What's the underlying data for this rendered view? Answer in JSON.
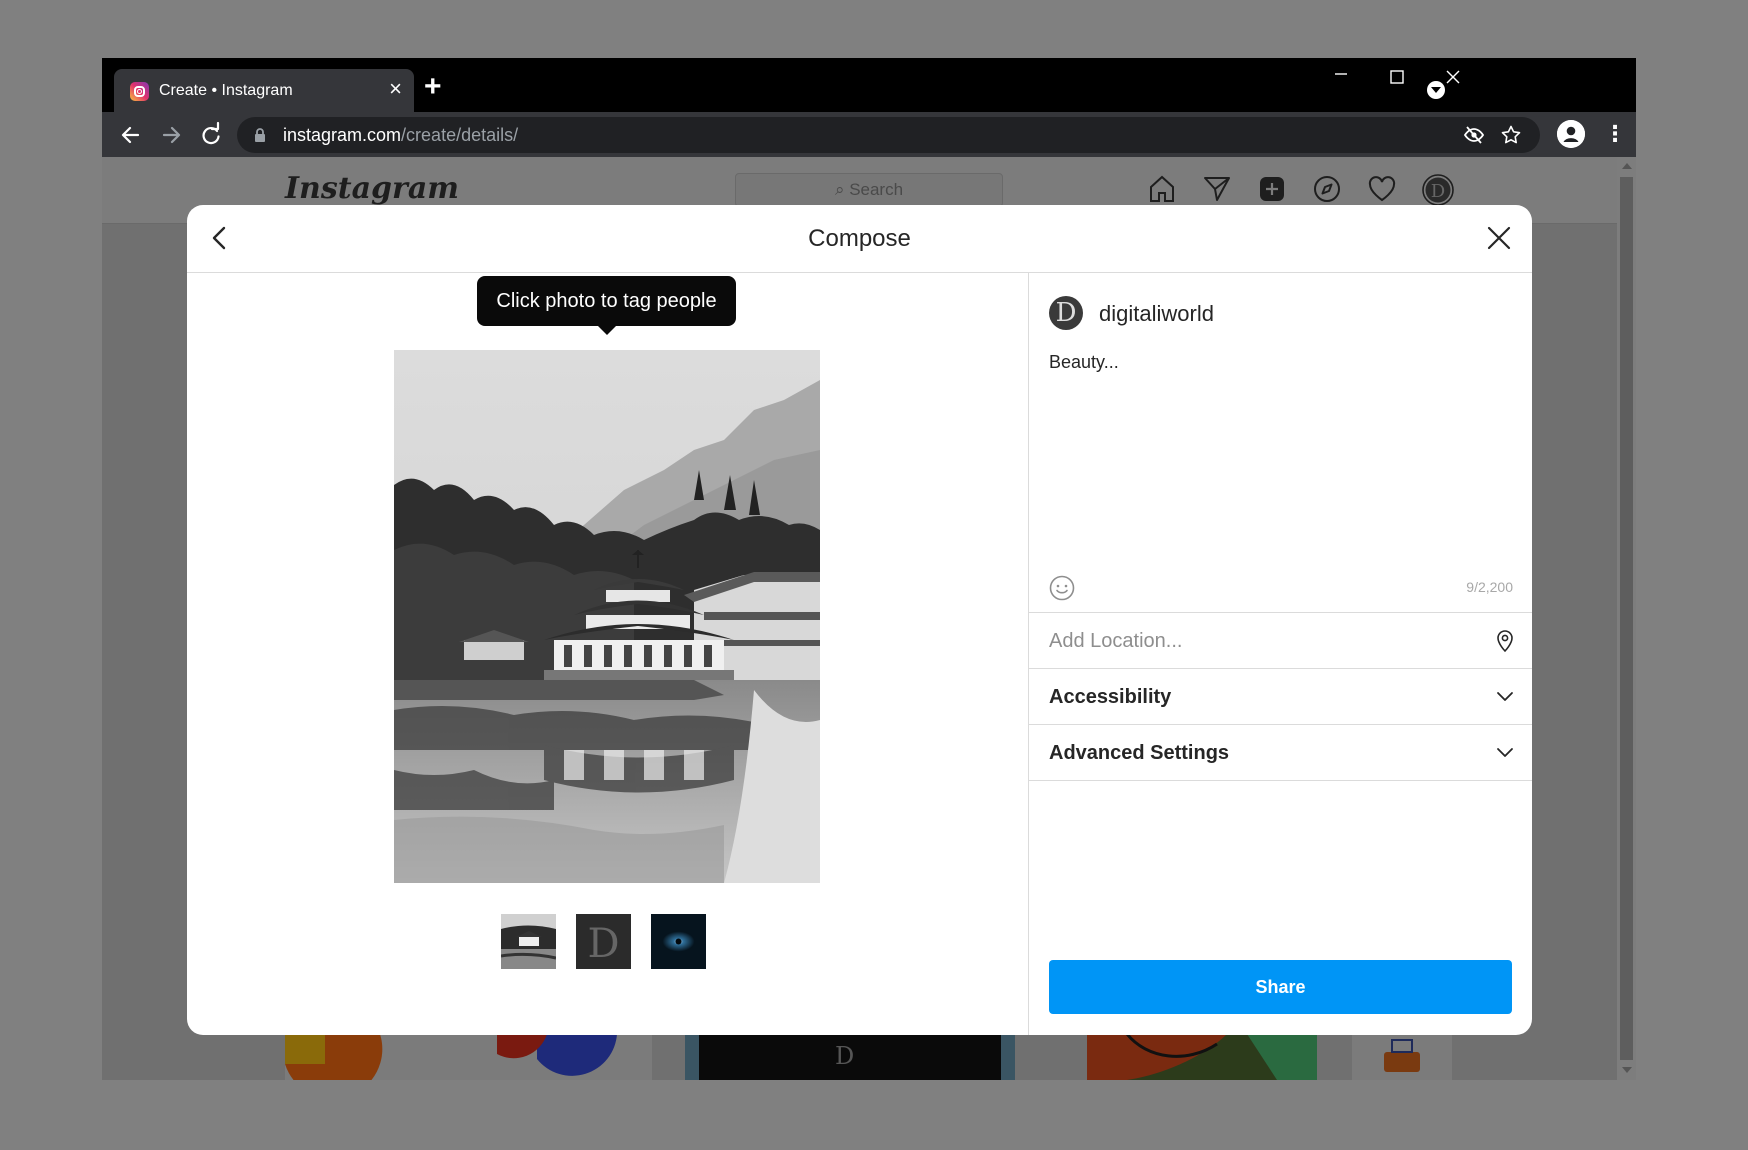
{
  "browser": {
    "tab_title": "Create • Instagram",
    "tab_close": "×",
    "new_tab": "+",
    "url_domain": "instagram.com",
    "url_path": "/create/details/",
    "menu_glyph": "⋮"
  },
  "instagram": {
    "logo": "Instagram",
    "search_placeholder": "Search"
  },
  "modal": {
    "title": "Compose",
    "tooltip": "Click photo to tag people",
    "username": "digitaliworld",
    "avatar_letter": "D",
    "caption": "Beauty...",
    "char_count": "9/2,200",
    "location_placeholder": "Add Location...",
    "accessibility_label": "Accessibility",
    "advanced_label": "Advanced Settings",
    "share_label": "Share",
    "thumbnail_letter": "D"
  },
  "colors": {
    "share_button": "#0095f6",
    "titlebar": "#000000",
    "toolbar": "#35363a",
    "backdrop": "#808080"
  }
}
